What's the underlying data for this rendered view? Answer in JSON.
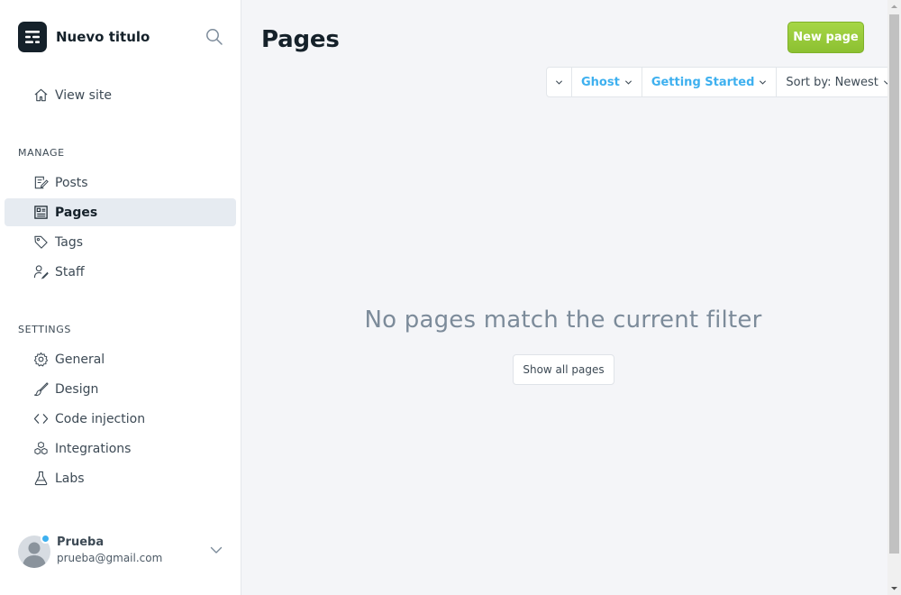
{
  "brand": {
    "title": "Nuevo titulo",
    "logo_icon": "ghost-logo-icon"
  },
  "nav": {
    "view_site": "View site",
    "manage_label": "MANAGE",
    "manage_items": [
      {
        "label": "Posts",
        "icon": "posts-icon"
      },
      {
        "label": "Pages",
        "icon": "pages-icon",
        "active": true
      },
      {
        "label": "Tags",
        "icon": "tag-icon"
      },
      {
        "label": "Staff",
        "icon": "staff-icon"
      }
    ],
    "settings_label": "SETTINGS",
    "settings_items": [
      {
        "label": "General",
        "icon": "gear-icon"
      },
      {
        "label": "Design",
        "icon": "brush-icon"
      },
      {
        "label": "Code injection",
        "icon": "code-icon"
      },
      {
        "label": "Integrations",
        "icon": "integrations-icon"
      },
      {
        "label": "Labs",
        "icon": "flask-icon"
      }
    ]
  },
  "user": {
    "name": "Prueba",
    "email": "prueba@gmail.com"
  },
  "main": {
    "title": "Pages",
    "new_button": "New page",
    "filters": {
      "author": "Ghost",
      "tag": "Getting Started",
      "sort": "Sort by: Newest"
    },
    "empty_message": "No pages match the current filter",
    "show_all": "Show all pages"
  },
  "colors": {
    "accent": "#3eb0ef",
    "primary_button": "#9fcf40",
    "sidebar_active": "#e6ebf1",
    "brand_dark": "#15212a"
  }
}
